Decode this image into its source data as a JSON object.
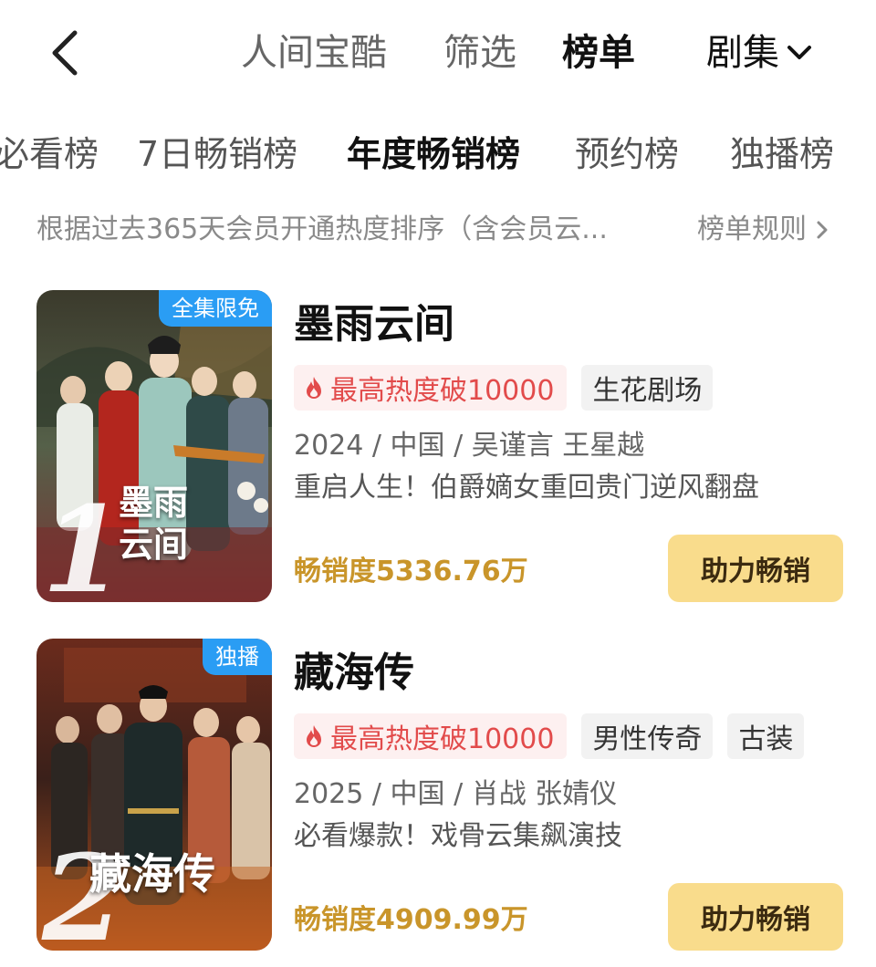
{
  "nav": {
    "tabs": [
      "人间宝酷",
      "筛选",
      "榜单"
    ],
    "active_tab": "榜单",
    "category": "剧集"
  },
  "sub_tabs": [
    "必看榜",
    "7日畅销榜",
    "年度畅销榜",
    "预约榜",
    "独播榜"
  ],
  "active_sub_tab": "年度畅销榜",
  "description": "根据过去365天会员开通热度排序（含会员云...",
  "rules_label": "榜单规则",
  "colors": {
    "accent_gold": "#c9952a",
    "button_bg": "#f9dc8c",
    "heat_red": "#e24b4b",
    "badge_blue": "#2a9df4"
  },
  "items": [
    {
      "rank": "1",
      "badge": "全集限免",
      "poster_title": "墨雨云间",
      "title": "墨雨云间",
      "heat": "最高热度破10000",
      "tags": [
        "生花剧场"
      ],
      "meta": "2024 / 中国 / 吴谨言 王星越",
      "blurb": "重启人生！伯爵嫡女重回贵门逆风翻盘",
      "sales": "畅销度5336.76万",
      "button": "助力畅销"
    },
    {
      "rank": "2",
      "badge": "独播",
      "poster_title": "藏海传",
      "title": "藏海传",
      "heat": "最高热度破10000",
      "tags": [
        "男性传奇",
        "古装"
      ],
      "meta": "2025 / 中国 / 肖战 张婧仪",
      "blurb": "必看爆款！戏骨云集飙演技",
      "sales": "畅销度4909.99万",
      "button": "助力畅销"
    }
  ]
}
